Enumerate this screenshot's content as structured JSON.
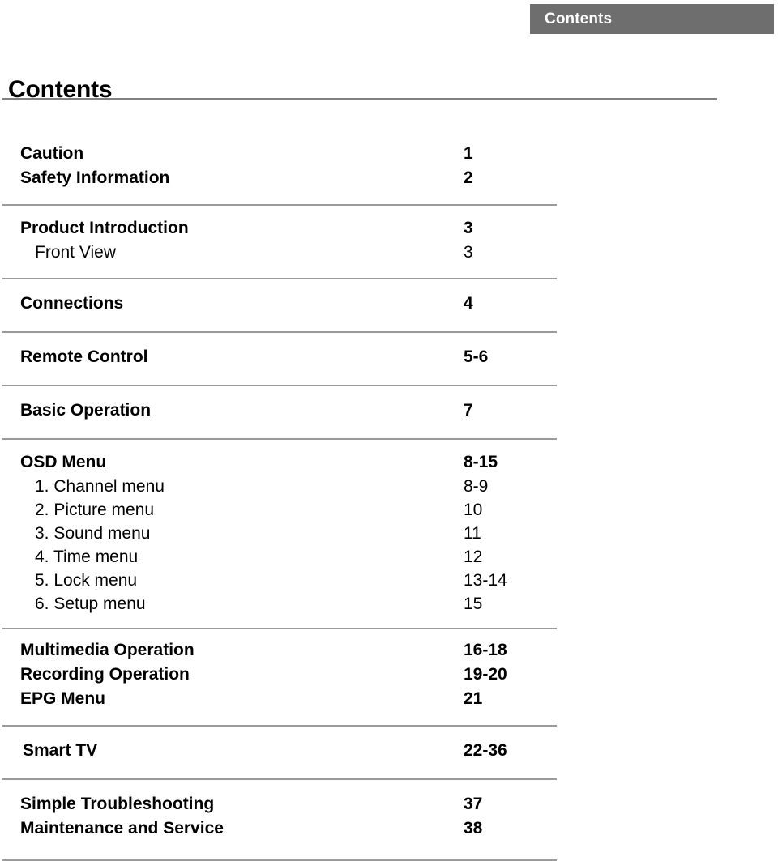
{
  "header": {
    "banner_label": "Contents"
  },
  "page_title": "Contents",
  "toc": {
    "groups": [
      {
        "id": "group-caution",
        "entries": [
          {
            "label": "Caution",
            "page": "1",
            "level": 1
          },
          {
            "label": "Safety Information",
            "page": "2",
            "level": 1
          }
        ]
      },
      {
        "id": "group-product-introduction",
        "entries": [
          {
            "label": "Product Introduction",
            "page": "3",
            "level": 1
          },
          {
            "label": "Front View",
            "page": "3",
            "level": 2
          }
        ]
      },
      {
        "id": "group-connections",
        "entries": [
          {
            "label": "Connections",
            "page": "4",
            "level": 1
          }
        ]
      },
      {
        "id": "group-remote-control",
        "entries": [
          {
            "label": "Remote Control",
            "page": "5-6",
            "level": 1
          }
        ]
      },
      {
        "id": "group-basic-operation",
        "entries": [
          {
            "label": "Basic Operation",
            "page": "7",
            "level": 1
          }
        ]
      },
      {
        "id": "group-osd-menu",
        "entries": [
          {
            "label": "OSD Menu",
            "page": "8-15",
            "level": 1
          },
          {
            "label": "1. Channel menu",
            "page": "8-9",
            "level": 2
          },
          {
            "label": "2. Picture menu",
            "page": "10",
            "level": 2
          },
          {
            "label": "3. Sound menu",
            "page": "11",
            "level": 2
          },
          {
            "label": "4. Time menu",
            "page": "12",
            "level": 2
          },
          {
            "label": "5. Lock menu",
            "page": "13-14",
            "level": 2
          },
          {
            "label": "6. Setup menu",
            "page": "15",
            "level": 2
          }
        ]
      },
      {
        "id": "group-multimedia",
        "entries": [
          {
            "label": "Multimedia Operation",
            "page": "16-18",
            "level": 1
          },
          {
            "label": "Recording Operation",
            "page": "19-20",
            "level": 1
          },
          {
            "label": "EPG Menu",
            "page": "21",
            "level": 1
          }
        ]
      },
      {
        "id": "group-smart-tv",
        "entries": [
          {
            "label": "Smart TV",
            "page": "22-36",
            "level": 1
          }
        ]
      },
      {
        "id": "group-troubleshooting",
        "entries": [
          {
            "label": "Simple Troubleshooting",
            "page": "37",
            "level": 1
          },
          {
            "label": "Maintenance and Service",
            "page": "38",
            "level": 1
          }
        ]
      }
    ]
  },
  "colors": {
    "banner_background": "#6e6e6e",
    "banner_text": "#ffffff",
    "title_rule": "#808080",
    "separator_rule": "#9a9a9a",
    "body_text": "#000000"
  }
}
